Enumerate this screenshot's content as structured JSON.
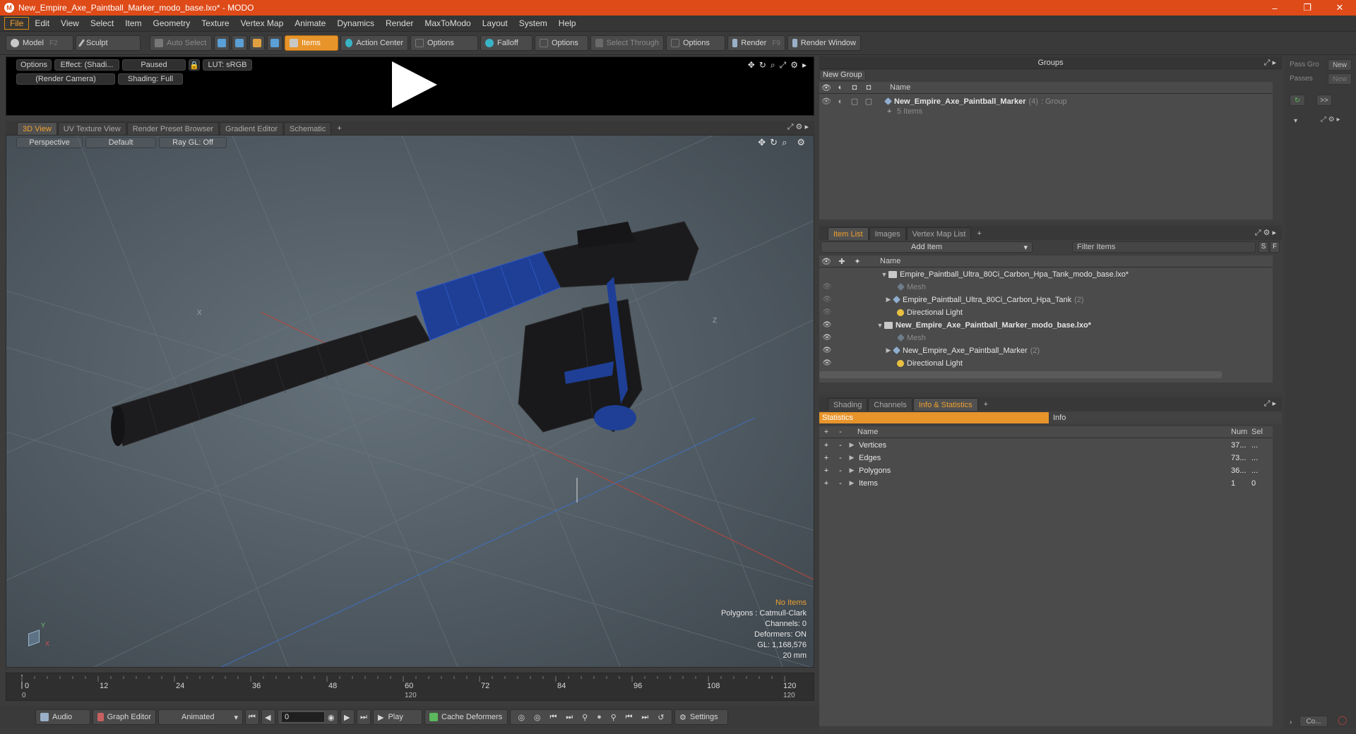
{
  "window": {
    "title": "New_Empire_Axe_Paintball_Marker_modo_base.lxo* - MODO",
    "minimize": "–",
    "restore": "❐",
    "close": "✕"
  },
  "menu": [
    "File",
    "Edit",
    "View",
    "Select",
    "Item",
    "Geometry",
    "Texture",
    "Vertex Map",
    "Animate",
    "Dynamics",
    "Render",
    "MaxToModo",
    "Layout",
    "System",
    "Help"
  ],
  "toolbar": {
    "model": "Model",
    "model_key": "F2",
    "sculpt": "Sculpt",
    "auto_select": "Auto Select",
    "items": "Items",
    "action_center": "Action Center",
    "options1": "Options",
    "falloff": "Falloff",
    "options2": "Options",
    "select_through": "Select Through",
    "options3": "Options",
    "render": "Render",
    "render_key": "F9",
    "render_window": "Render Window"
  },
  "preview": {
    "options": "Options",
    "effect": "Effect: (Shadi...",
    "paused": "Paused",
    "lut": "LUT: sRGB",
    "camera": "(Render Camera)",
    "shading": "Shading: Full"
  },
  "view_tabs": [
    "3D View",
    "UV Texture View",
    "Render Preset Browser",
    "Gradient Editor",
    "Schematic"
  ],
  "viewport": {
    "perspective": "Perspective",
    "default": "Default",
    "raygl": "Ray GL: Off",
    "axis_x": "X",
    "axis_z": "Z",
    "stats": {
      "no_items": "No Items",
      "polygons": "Polygons : Catmull-Clark",
      "channels": "Channels: 0",
      "deformers": "Deformers: ON",
      "gl": "GL: 1,168,576",
      "scale": "20 mm"
    }
  },
  "timeline": {
    "ticks": [
      "0",
      "12",
      "24",
      "36",
      "48",
      "60",
      "72",
      "84",
      "96",
      "108",
      "120"
    ],
    "lower": [
      "0",
      "120",
      "120"
    ]
  },
  "bottombar": {
    "audio": "Audio",
    "graph_editor": "Graph Editor",
    "animated": "Animated",
    "frame": "0",
    "play": "Play",
    "cache_deformers": "Cache Deformers",
    "settings": "Settings"
  },
  "groups": {
    "header": "Groups",
    "new_group": "New Group",
    "col_name": "Name",
    "group_name": "New_Empire_Axe_Paintball_Marker",
    "group_count": "(4)",
    "group_type": ": Group",
    "group_items": "5 Items"
  },
  "right_side": {
    "pass_gro": "Pass Gro",
    "new1": "New",
    "passes": "Passes",
    "new2": "New",
    "more": ">>",
    "bottom": "Co..."
  },
  "item_list": {
    "tabs": [
      "Item List",
      "Images",
      "Vertex Map List"
    ],
    "add_item": "Add Item",
    "filter": "Filter Items",
    "s": "S",
    "f": "F",
    "col_name": "Name",
    "rows": [
      {
        "label": "Empire_Paintball_Ultra_80Ci_Carbon_Hpa_Tank_modo_base.lxo*",
        "count": ""
      },
      {
        "label": "Mesh",
        "count": ""
      },
      {
        "label": "Empire_Paintball_Ultra_80Ci_Carbon_Hpa_Tank",
        "count": "(2)"
      },
      {
        "label": "Directional Light",
        "count": ""
      },
      {
        "label": "New_Empire_Axe_Paintball_Marker_modo_base.lxo*",
        "count": ""
      },
      {
        "label": "Mesh",
        "count": ""
      },
      {
        "label": "New_Empire_Axe_Paintball_Marker",
        "count": "(2)"
      },
      {
        "label": "Directional Light",
        "count": ""
      }
    ]
  },
  "info_stats": {
    "tabs": [
      "Shading",
      "Channels",
      "Info & Statistics"
    ],
    "statistics": "Statistics",
    "info": "Info",
    "col_name": "Name",
    "col_num": "Num",
    "col_sel": "Sel",
    "rows": [
      {
        "name": "Vertices",
        "num": "37...",
        "sel": "..."
      },
      {
        "name": "Edges",
        "num": "73...",
        "sel": "..."
      },
      {
        "name": "Polygons",
        "num": "36...",
        "sel": "..."
      },
      {
        "name": "Items",
        "num": "1",
        "sel": "0"
      }
    ]
  },
  "colors": {
    "accent": "#de4a18",
    "active_tab": "#f0a030",
    "mesh_blue": "#2255c8"
  }
}
